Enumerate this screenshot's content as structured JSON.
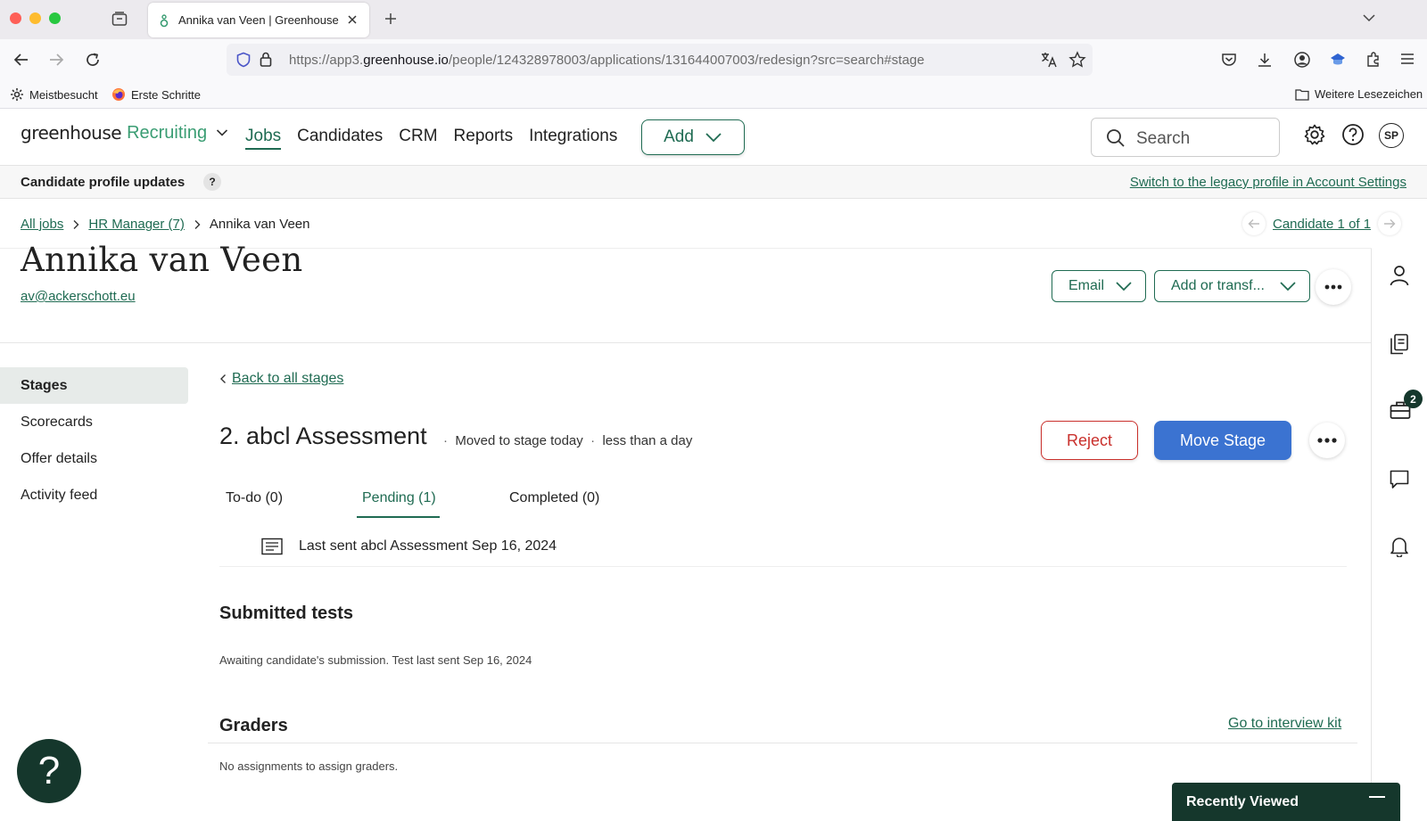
{
  "browser": {
    "tab_title": "Annika van Veen | Greenhouse",
    "url_prefix": "https://app3.",
    "url_domain": "greenhouse.io",
    "url_path": "/people/124328978003/applications/131644007003/redesign?src=search#stage",
    "bookmarks": [
      "Meistbesucht",
      "Erste Schritte"
    ],
    "other_bookmarks": "Weitere Lesezeichen"
  },
  "app": {
    "logo_main": "greenhouse",
    "logo_product": "Recruiting",
    "nav": [
      "Jobs",
      "Candidates",
      "CRM",
      "Reports",
      "Integrations"
    ],
    "add_label": "Add",
    "search_placeholder": "Search",
    "avatar_initials": "SP"
  },
  "notice": {
    "title": "Candidate profile updates",
    "help": "?",
    "link": "Switch to the legacy profile in Account Settings"
  },
  "breadcrumb": {
    "all_jobs": "All jobs",
    "job": "HR Manager (7)",
    "current": "Annika van Veen",
    "candidate_pager": "Candidate 1 of 1"
  },
  "candidate": {
    "name": "Annika van Veen",
    "email": "av@ackerschott.eu",
    "email_button": "Email",
    "transfer_button": "Add or transf..."
  },
  "sidebar": {
    "items": [
      "Stages",
      "Scorecards",
      "Offer details",
      "Activity feed"
    ]
  },
  "stage": {
    "back_link": "Back to all stages",
    "title": "2. abcl Assessment",
    "moved": "Moved to stage today",
    "duration": "less than a day",
    "reject_label": "Reject",
    "move_label": "Move Stage",
    "tabs": [
      "To-do (0)",
      "Pending (1)",
      "Completed (0)"
    ],
    "pending_item": "Last sent abcl Assessment Sep 16, 2024",
    "submitted_title": "Submitted tests",
    "submitted_text": "Awaiting candidate's submission. Test last sent Sep 16, 2024",
    "graders_title": "Graders",
    "interview_kit": "Go to interview kit",
    "graders_text": "No assignments to assign graders."
  },
  "rail": {
    "badge_count": "2"
  },
  "widgets": {
    "help_fab": "?",
    "recently_viewed": "Recently Viewed"
  },
  "colors": {
    "brand_green": "#1f6b52",
    "dark_green": "#15372c",
    "reject_red": "#c9302c",
    "move_blue": "#3b73d1"
  }
}
